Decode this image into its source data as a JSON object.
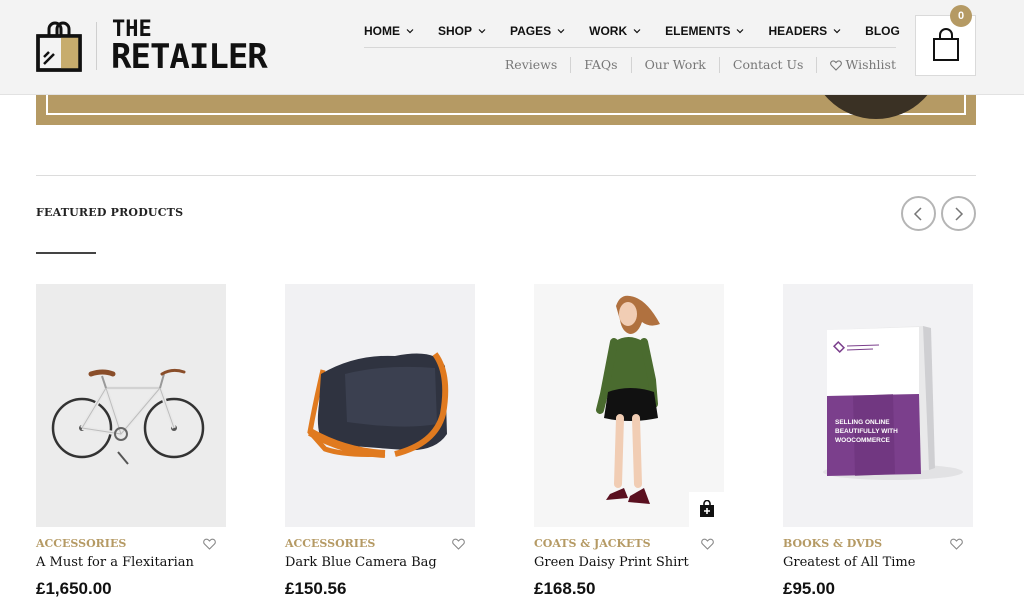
{
  "brand": {
    "line1": "THE",
    "line2": "RETAILER"
  },
  "main_nav": [
    {
      "label": "HOME",
      "has_dropdown": true
    },
    {
      "label": "SHOP",
      "has_dropdown": true
    },
    {
      "label": "PAGES",
      "has_dropdown": true
    },
    {
      "label": "WORK",
      "has_dropdown": true
    },
    {
      "label": "ELEMENTS",
      "has_dropdown": true
    },
    {
      "label": "HEADERS",
      "has_dropdown": true
    },
    {
      "label": "BLOG",
      "has_dropdown": false
    }
  ],
  "sub_nav": [
    {
      "label": "Reviews"
    },
    {
      "label": "FAQs"
    },
    {
      "label": "Our Work"
    },
    {
      "label": "Contact Us"
    },
    {
      "label": "Wishlist",
      "icon": "heart-icon"
    }
  ],
  "cart": {
    "count": "0",
    "icon": "shopping-bag-icon"
  },
  "section": {
    "title": "FEATURED PRODUCTS"
  },
  "products": [
    {
      "category": "ACCESSORIES",
      "name": "A Must for a Flexitarian",
      "price": "£1,650.00",
      "image": "bicycle"
    },
    {
      "category": "ACCESSORIES",
      "name": "Dark Blue Camera Bag",
      "price": "£150.56",
      "image": "messenger-bag"
    },
    {
      "category": "COATS & JACKETS",
      "name": "Green Daisy Print Shirt",
      "price": "£168.50",
      "image": "model-in-shirt"
    },
    {
      "category": "BOOKS & DVDS",
      "name": "Greatest of All Time",
      "price": "£95.00",
      "image": "book",
      "book_cover": [
        "SELLING ONLINE",
        "BEAUTIFULLY WITH",
        "WOOCOMMERCE"
      ]
    }
  ],
  "colors": {
    "accent": "#b59a64",
    "banner_dark": "#3a3124",
    "header_bg": "#f3f3f3",
    "book_purple": "#7b3f8c"
  }
}
